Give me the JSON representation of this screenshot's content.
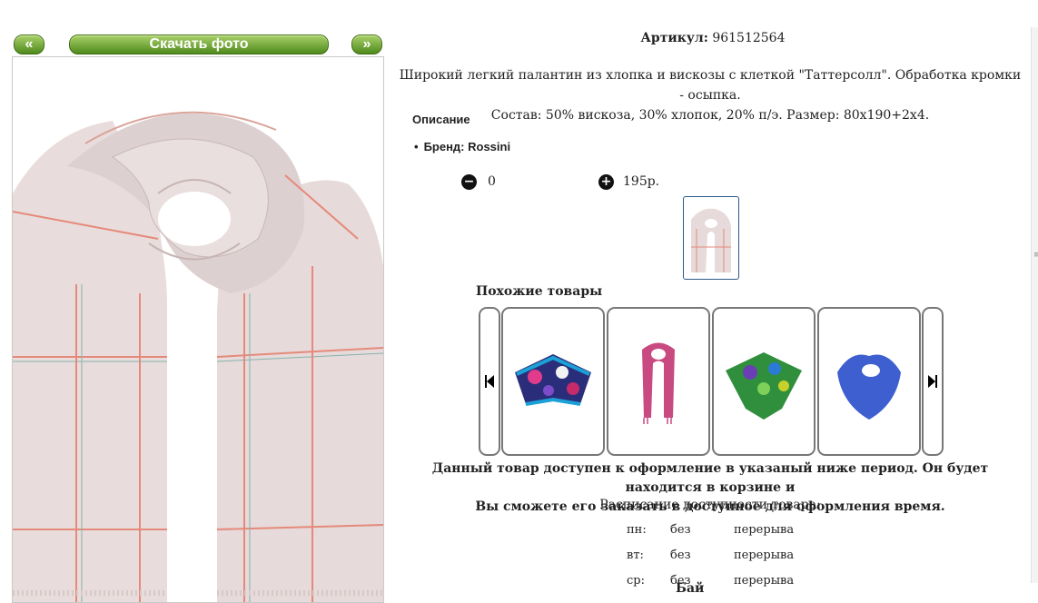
{
  "gallery": {
    "prev_label": "«",
    "next_label": "»",
    "download_label": "Скачать фото"
  },
  "product": {
    "sku_label": "Артикул:",
    "sku_value": "961512564",
    "description_line1": "Широкий легкий палантин из хлопка и вискозы с клеткой \"Таттерсолл\". Обработка кромки - осыпка.",
    "description_line2": "Состав: 50% вискоза, 30% хлопок, 20% п/э. Размер: 80х190+2х4.",
    "section_title": "Описание",
    "brand": "Бренд: Rossini",
    "quantity": "0",
    "price": "195р.",
    "minus_icon": "−",
    "plus_icon": "+"
  },
  "similar": {
    "title": "Похожие товары",
    "items": [
      {
        "name": "silk-scarf-floral-blue"
      },
      {
        "name": "pink-scarf"
      },
      {
        "name": "green-floral-scarf"
      },
      {
        "name": "blue-scarf"
      }
    ]
  },
  "notice": {
    "line1": "Данный товар доступен к оформление в указаный ниже период. Он будет находится в корзине и",
    "line2": "Вы сможете его заказать в доступное для оформления время."
  },
  "schedule": {
    "title": "Расписание доступности товара:",
    "rows": [
      {
        "day": "пн:",
        "col2": "без",
        "col3": "перерыва"
      },
      {
        "day": "вт:",
        "col2": "без",
        "col3": "перерыва"
      },
      {
        "day": "ср:",
        "col2": "без",
        "col3": "перерыва"
      }
    ],
    "cut_text": "Бай"
  },
  "colors": {
    "button_green": "#6fae2e",
    "scarf_main": "#e8dcdc",
    "check_red": "#e58a7a",
    "check_teal": "#86b3ad"
  }
}
